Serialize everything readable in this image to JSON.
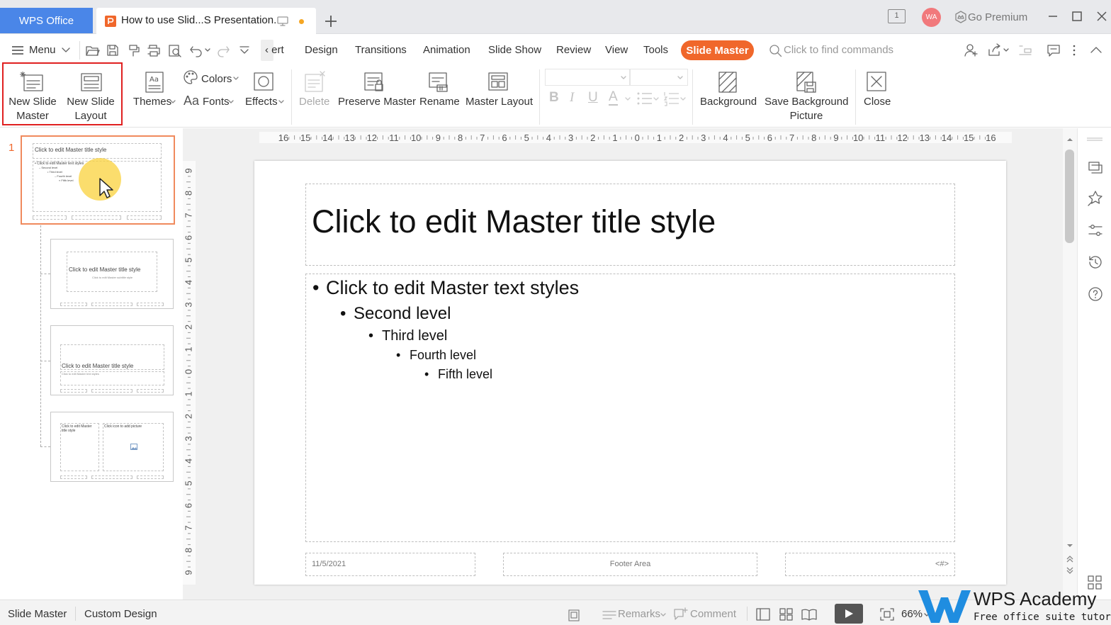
{
  "titlebar": {
    "app_tab": "WPS Office",
    "doc_tab": "How to use Slid...S Presentation.",
    "window_count": "1",
    "avatar": "WA",
    "premium": "Go Premium"
  },
  "menubar": {
    "menu": "Menu",
    "tabs": [
      "‹ ert",
      "Design",
      "Transitions",
      "Animation",
      "Slide Show",
      "Review",
      "View",
      "Tools"
    ],
    "active_tab": "Slide Master",
    "search_placeholder": "Click to find commands"
  },
  "ribbon": {
    "new_slide_master": [
      "New Slide",
      "Master"
    ],
    "new_slide_layout": [
      "New Slide",
      "Layout"
    ],
    "themes": "Themes",
    "colors": "Colors",
    "fonts": "Fonts",
    "effects": "Effects",
    "delete": "Delete",
    "preserve_master": "Preserve Master",
    "rename": "Rename",
    "master_layout": "Master Layout",
    "background": "Background",
    "save_background_picture": [
      "Save Background",
      "Picture"
    ],
    "close": "Close"
  },
  "thumbnails": {
    "master_number": "1",
    "master": {
      "title": "Click to edit Master title style",
      "body": [
        "• Click to edit Master text styles",
        "– Second level",
        "• Third level",
        "– Fourth level",
        "» Fifth level"
      ]
    },
    "layout1": {
      "title": "Click to edit Master title style",
      "subtitle": "Click to edit Master subtitle style"
    },
    "layout2": {
      "title": "Click to edit Master title style",
      "subtitle": "Click to edit Master text styles"
    },
    "layout3": {
      "title_l1": "Click to edit Master",
      "title_l2": "title style",
      "picture": "Click icon to add picture"
    }
  },
  "ruler": {
    "h_ticks": [
      "16",
      "15",
      "14",
      "13",
      "12",
      "11",
      "10",
      "9",
      "8",
      "7",
      "6",
      "5",
      "4",
      "3",
      "2",
      "1",
      "0",
      "1",
      "2",
      "3",
      "4",
      "5",
      "6",
      "7",
      "8",
      "9",
      "10",
      "11",
      "12",
      "13",
      "14",
      "15",
      "16"
    ],
    "v_ticks": [
      "9",
      "8",
      "7",
      "6",
      "5",
      "4",
      "3",
      "2",
      "1",
      "0",
      "1",
      "2",
      "3",
      "4",
      "5",
      "6",
      "7",
      "8",
      "9"
    ]
  },
  "slide": {
    "title": "Click to edit Master title style",
    "levels": [
      "Click to edit Master text styles",
      "Second level",
      "Third level",
      "Fourth level",
      "Fifth level"
    ],
    "date": "11/5/2021",
    "footer": "Footer Area",
    "page_num": "<#>"
  },
  "statusbar": {
    "view": "Slide Master",
    "design": "Custom Design",
    "remarks": "Remarks",
    "comment": "Comment",
    "zoom": "66%"
  },
  "watermark": {
    "brand": "WPS Academy",
    "tagline": "Free office suite tutorials"
  },
  "colors": {
    "accent": "#f0672b",
    "tab_blue": "#4a86e8",
    "highlight_red": "#e02020",
    "selection_orange": "#f08a5d"
  }
}
